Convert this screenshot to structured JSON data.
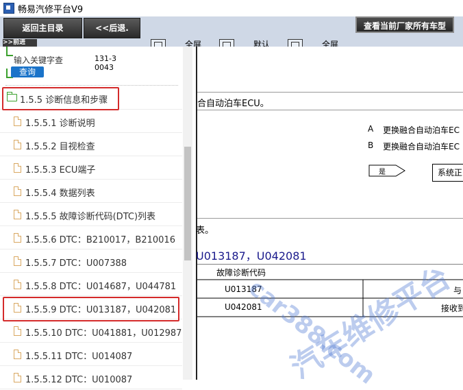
{
  "app": {
    "title": "畅易汽修平台V9"
  },
  "toolbar": {
    "home_btn": "返回主目录",
    "back_btn": "<<后退.",
    "forward_btn": ">>前进",
    "fullscreen1": "全屏",
    "default_label": "默认",
    "fullscreen2": "全屏",
    "maker_btn": "查看当前厂家所有车型"
  },
  "search": {
    "placeholder": "输入关键字查",
    "button": "查询",
    "code": "131-30043"
  },
  "tree": {
    "folder": {
      "label": "1.5.5 诊断信息和步骤"
    },
    "items": [
      {
        "label": "1.5.5.1 诊断说明"
      },
      {
        "label": "1.5.5.2 目视检查"
      },
      {
        "label": "1.5.5.3 ECU端子"
      },
      {
        "label": "1.5.5.4 数据列表"
      },
      {
        "label": "1.5.5.5 故障诊断代码(DTC)列表"
      },
      {
        "label": "1.5.5.6 DTC：B210017，B210016"
      },
      {
        "label": "1.5.5.7 DTC：U007388"
      },
      {
        "label": "1.5.5.8 DTC：U014687，U044781"
      },
      {
        "label": "1.5.5.9 DTC：U013187，U042081"
      },
      {
        "label": "1.5.5.10 DTC：U041881，U012987"
      },
      {
        "label": "1.5.5.11 DTC：U014087"
      },
      {
        "label": "1.5.5.12 DTC：U010087"
      }
    ]
  },
  "doc": {
    "line1": "合自动泊车ECU。",
    "opt_a_letter": "A",
    "opt_a_text": "更换融合自动泊车EC",
    "opt_b_letter": "B",
    "opt_b_text": "更换融合自动泊车EC",
    "arrow_label": "是",
    "box_label": "系统正",
    "line_table": "表。",
    "dtc_title": "U013187，U042081",
    "table_header": "故障诊断代码",
    "rows": [
      {
        "code": "U013187",
        "desc": "与"
      },
      {
        "code": "U042081",
        "desc": "接收到"
      }
    ]
  },
  "watermark": {
    "text1": "car388.com",
    "text2": "汽车维修平台"
  }
}
